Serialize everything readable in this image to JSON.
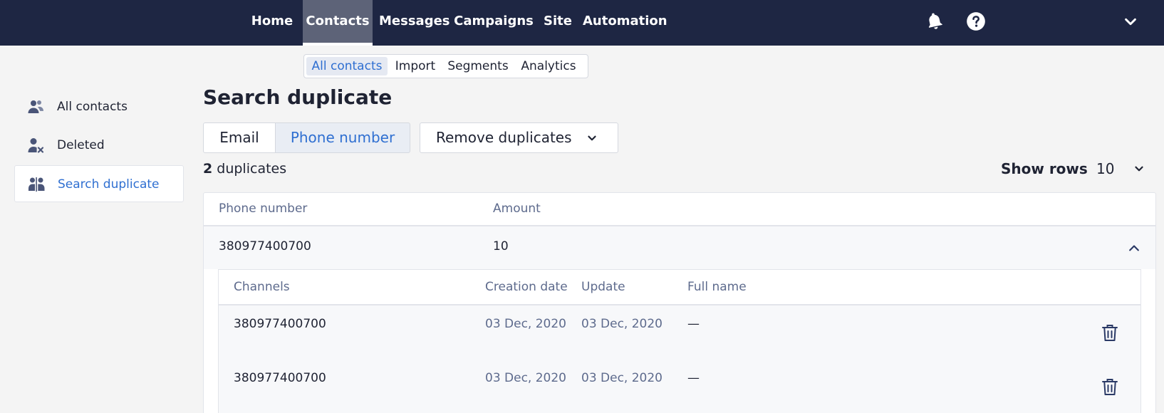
{
  "nav": {
    "items": [
      {
        "label": "Home"
      },
      {
        "label": "Contacts",
        "active": true
      },
      {
        "label": "Messages"
      },
      {
        "label": "Campaigns"
      },
      {
        "label": "Site"
      },
      {
        "label": "Automation"
      }
    ],
    "icons": [
      "bell-icon",
      "help-icon",
      "chevron-down-icon"
    ]
  },
  "subnav": {
    "items": [
      {
        "label": "All contacts",
        "active": true
      },
      {
        "label": "Import"
      },
      {
        "label": "Segments"
      },
      {
        "label": "Analytics"
      }
    ]
  },
  "sidebar": {
    "items": [
      {
        "label": "All contacts",
        "icon": "contacts-icon"
      },
      {
        "label": "Deleted",
        "icon": "user-remove-icon"
      },
      {
        "label": "Search duplicate",
        "icon": "duplicate-users-icon",
        "active": true
      }
    ]
  },
  "main": {
    "title": "Search duplicate",
    "segments": [
      {
        "label": "Email"
      },
      {
        "label": "Phone number",
        "active": true
      }
    ],
    "remove_label": "Remove duplicates",
    "count_value": "2",
    "count_text": " duplicates",
    "show_rows_label": "Show rows",
    "show_rows_value": "10"
  },
  "table": {
    "headers": {
      "phone": "Phone number",
      "amount": "Amount"
    },
    "group": {
      "phone": "380977400700",
      "amount": "10"
    },
    "inner_headers": {
      "channels": "Channels",
      "creation": "Creation date",
      "update": "Update",
      "fullname": "Full name"
    },
    "rows": [
      {
        "channel": "380977400700",
        "created": "03 Dec, 2020",
        "updated": "03 Dec, 2020",
        "fullname": "—"
      },
      {
        "channel": "380977400700",
        "created": "03 Dec, 2020",
        "updated": "03 Dec, 2020",
        "fullname": "—"
      }
    ]
  },
  "colors": {
    "nav_bg": "#1e2643",
    "accent": "#2f6fd1",
    "muted_text": "#5e6b8d"
  }
}
